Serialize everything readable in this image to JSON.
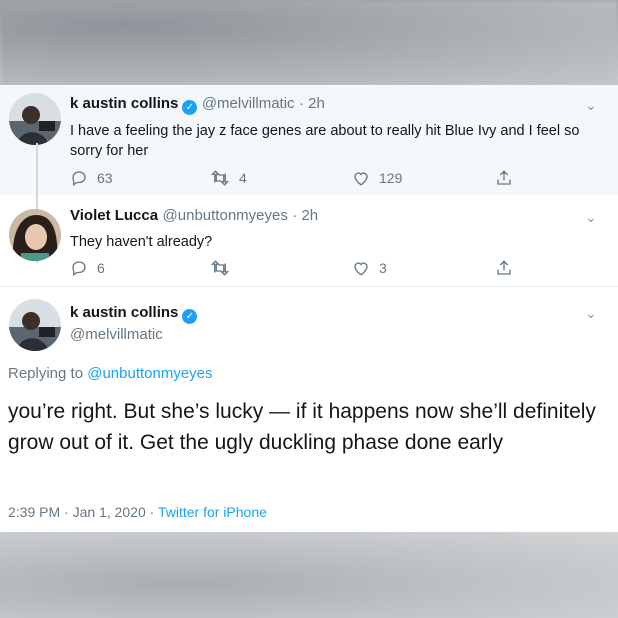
{
  "tweets": [
    {
      "name": "k austin collins",
      "handle": "@melvillmatic",
      "time": "· 2h",
      "text": "I have a feeling the jay z face genes are about to really hit Blue Ivy and I feel so sorry for her",
      "replies": "63",
      "retweets": "4",
      "likes": "129"
    },
    {
      "name": "Violet Lucca",
      "handle": "@unbuttonmyeyes",
      "time": "· 2h",
      "text": "They haven't already?",
      "replies": "6",
      "retweets": "",
      "likes": "3"
    }
  ],
  "main": {
    "name": "k austin collins",
    "handle": "@melvillmatic",
    "replying_prefix": "Replying to ",
    "replying_to": "@unbuttonmyeyes",
    "text": "you’re right. But she’s lucky — if it happens now she’ll definitely grow out of it. Get the ugly duckling phase done early",
    "timestamp": "2:39 PM · Jan 1, 2020 · ",
    "source": "Twitter for iPhone"
  },
  "colors": {
    "accent": "#1da1f2",
    "text": "#14171a",
    "muted": "#657786"
  },
  "icons": [
    "reply-icon",
    "retweet-icon",
    "like-icon",
    "share-icon",
    "verified-icon",
    "chevron-down-icon"
  ]
}
